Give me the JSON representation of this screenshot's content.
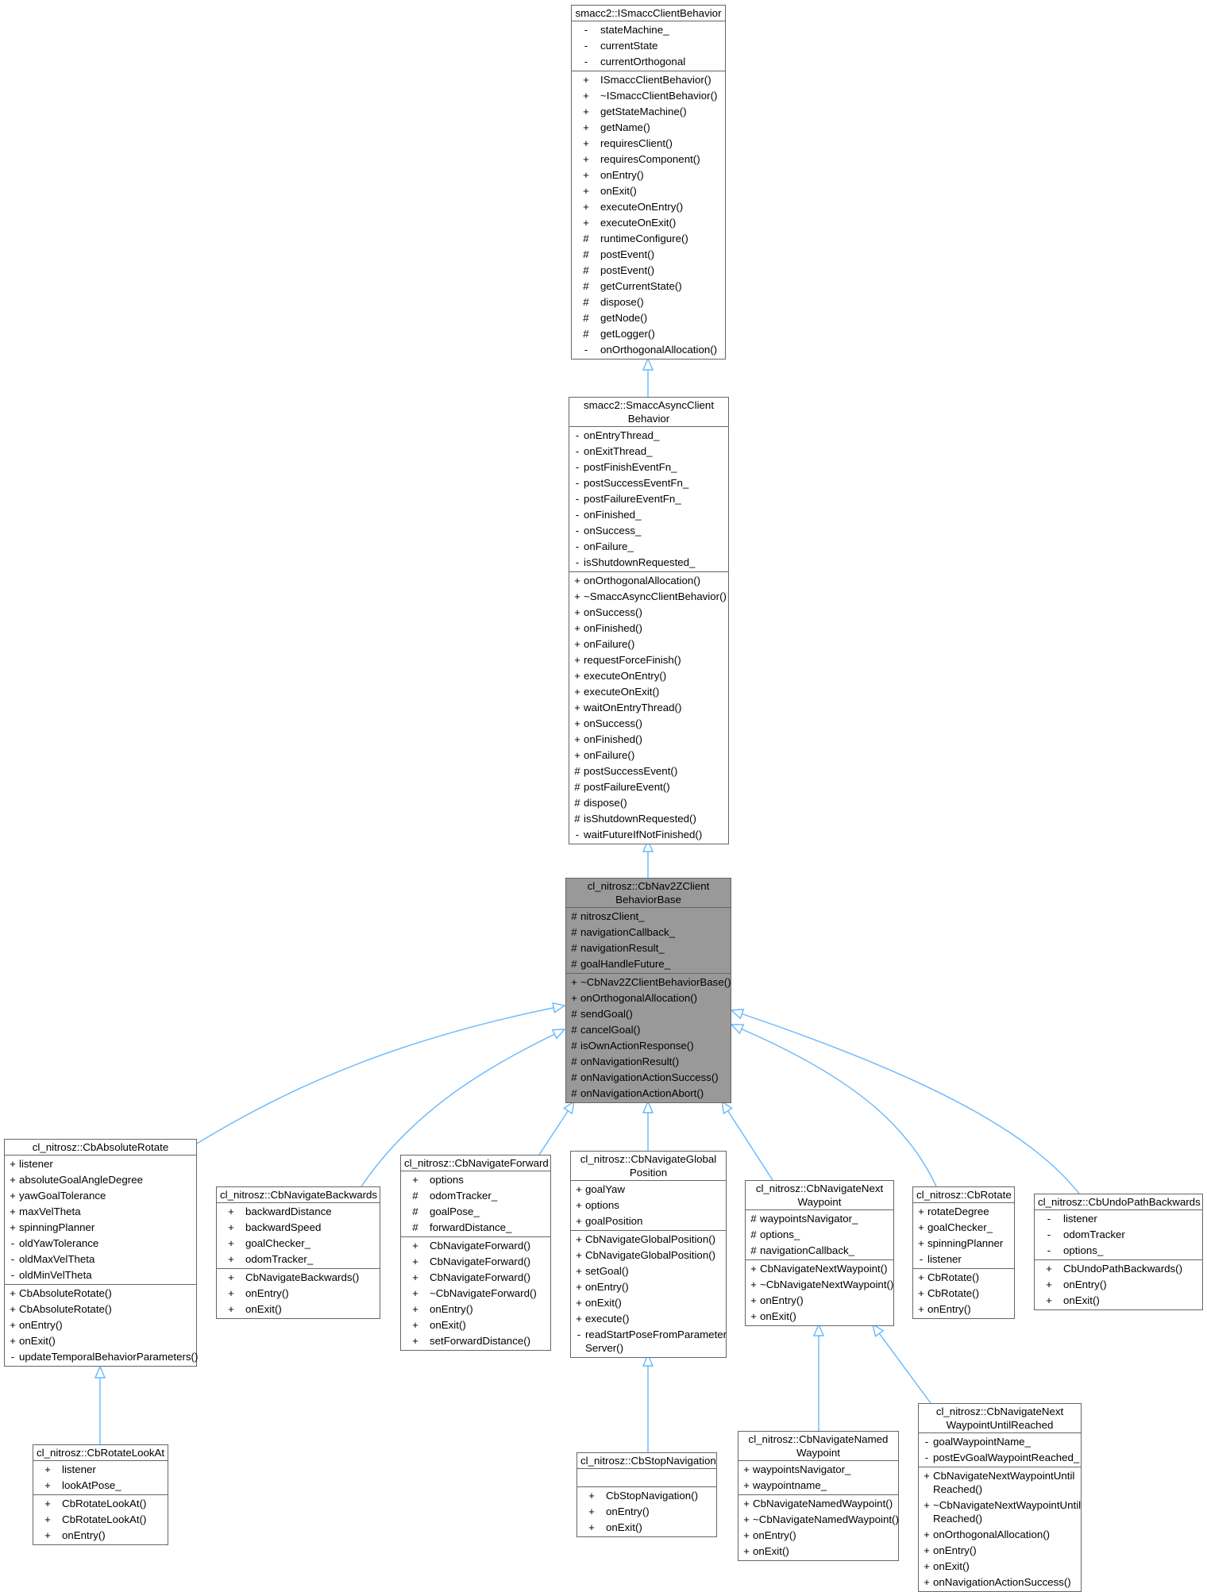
{
  "diagram": {
    "type": "class-inheritance-graph",
    "edge_color": "#63b8ff",
    "focus_fill": "#999999",
    "classes": [
      {
        "id": "ismacc",
        "name": "smacc2::ISmaccClientBehavior",
        "attributes": [
          {
            "vis": "-",
            "name": "stateMachine_"
          },
          {
            "vis": "-",
            "name": "currentState"
          },
          {
            "vis": "-",
            "name": "currentOrthogonal"
          }
        ],
        "methods": [
          {
            "vis": "+",
            "name": "ISmaccClientBehavior()"
          },
          {
            "vis": "+",
            "name": "~ISmaccClientBehavior()"
          },
          {
            "vis": "+",
            "name": "getStateMachine()"
          },
          {
            "vis": "+",
            "name": "getName()"
          },
          {
            "vis": "+",
            "name": "requiresClient()"
          },
          {
            "vis": "+",
            "name": "requiresComponent()"
          },
          {
            "vis": "+",
            "name": "onEntry()"
          },
          {
            "vis": "+",
            "name": "onExit()"
          },
          {
            "vis": "+",
            "name": "executeOnEntry()"
          },
          {
            "vis": "+",
            "name": "executeOnExit()"
          },
          {
            "vis": "#",
            "name": "runtimeConfigure()"
          },
          {
            "vis": "#",
            "name": "postEvent()"
          },
          {
            "vis": "#",
            "name": "postEvent()"
          },
          {
            "vis": "#",
            "name": "getCurrentState()"
          },
          {
            "vis": "#",
            "name": "dispose()"
          },
          {
            "vis": "#",
            "name": "getNode()"
          },
          {
            "vis": "#",
            "name": "getLogger()"
          },
          {
            "vis": "-",
            "name": "onOrthogonalAllocation()"
          }
        ]
      },
      {
        "id": "async",
        "name": "smacc2::SmaccAsyncClient\nBehavior",
        "attributes": [
          {
            "vis": "-",
            "name": "onEntryThread_"
          },
          {
            "vis": "-",
            "name": "onExitThread_"
          },
          {
            "vis": "-",
            "name": "postFinishEventFn_"
          },
          {
            "vis": "-",
            "name": "postSuccessEventFn_"
          },
          {
            "vis": "-",
            "name": "postFailureEventFn_"
          },
          {
            "vis": "-",
            "name": "onFinished_"
          },
          {
            "vis": "-",
            "name": "onSuccess_"
          },
          {
            "vis": "-",
            "name": "onFailure_"
          },
          {
            "vis": "-",
            "name": "isShutdownRequested_"
          }
        ],
        "methods": [
          {
            "vis": "+",
            "name": "onOrthogonalAllocation()"
          },
          {
            "vis": "+",
            "name": "~SmaccAsyncClientBehavior()"
          },
          {
            "vis": "+",
            "name": "onSuccess()"
          },
          {
            "vis": "+",
            "name": "onFinished()"
          },
          {
            "vis": "+",
            "name": "onFailure()"
          },
          {
            "vis": "+",
            "name": "requestForceFinish()"
          },
          {
            "vis": "+",
            "name": "executeOnEntry()"
          },
          {
            "vis": "+",
            "name": "executeOnExit()"
          },
          {
            "vis": "+",
            "name": "waitOnEntryThread()"
          },
          {
            "vis": "+",
            "name": "onSuccess()"
          },
          {
            "vis": "+",
            "name": "onFinished()"
          },
          {
            "vis": "+",
            "name": "onFailure()"
          },
          {
            "vis": "#",
            "name": "postSuccessEvent()"
          },
          {
            "vis": "#",
            "name": "postFailureEvent()"
          },
          {
            "vis": "#",
            "name": "dispose()"
          },
          {
            "vis": "#",
            "name": "isShutdownRequested()"
          },
          {
            "vis": "-",
            "name": "waitFutureIfNotFinished()"
          }
        ]
      },
      {
        "id": "base",
        "name": "cl_nitrosz::CbNav2ZClient\nBehaviorBase",
        "focus": true,
        "attributes": [
          {
            "vis": "#",
            "name": "nitroszClient_"
          },
          {
            "vis": "#",
            "name": "navigationCallback_"
          },
          {
            "vis": "#",
            "name": "navigationResult_"
          },
          {
            "vis": "#",
            "name": "goalHandleFuture_"
          }
        ],
        "methods": [
          {
            "vis": "+",
            "name": "~CbNav2ZClientBehaviorBase()"
          },
          {
            "vis": "+",
            "name": "onOrthogonalAllocation()"
          },
          {
            "vis": "#",
            "name": "sendGoal()"
          },
          {
            "vis": "#",
            "name": "cancelGoal()"
          },
          {
            "vis": "#",
            "name": "isOwnActionResponse()"
          },
          {
            "vis": "#",
            "name": "onNavigationResult()"
          },
          {
            "vis": "#",
            "name": "onNavigationActionSuccess()"
          },
          {
            "vis": "#",
            "name": "onNavigationActionAbort()"
          }
        ]
      },
      {
        "id": "absrot",
        "name": "cl_nitrosz::CbAbsoluteRotate",
        "attributes": [
          {
            "vis": "+",
            "name": "listener"
          },
          {
            "vis": "+",
            "name": "absoluteGoalAngleDegree"
          },
          {
            "vis": "+",
            "name": "yawGoalTolerance"
          },
          {
            "vis": "+",
            "name": "maxVelTheta"
          },
          {
            "vis": "+",
            "name": "spinningPlanner"
          },
          {
            "vis": "-",
            "name": "oldYawTolerance"
          },
          {
            "vis": "-",
            "name": "oldMaxVelTheta"
          },
          {
            "vis": "-",
            "name": "oldMinVelTheta"
          }
        ],
        "methods": [
          {
            "vis": "+",
            "name": "CbAbsoluteRotate()"
          },
          {
            "vis": "+",
            "name": "CbAbsoluteRotate()"
          },
          {
            "vis": "+",
            "name": "onEntry()"
          },
          {
            "vis": "+",
            "name": "onExit()"
          },
          {
            "vis": "-",
            "name": "updateTemporalBehaviorParameters()"
          }
        ]
      },
      {
        "id": "navback",
        "name": "cl_nitrosz::CbNavigateBackwards",
        "attributes": [
          {
            "vis": "+",
            "name": "backwardDistance"
          },
          {
            "vis": "+",
            "name": "backwardSpeed"
          },
          {
            "vis": "+",
            "name": "goalChecker_"
          },
          {
            "vis": "+",
            "name": "odomTracker_"
          }
        ],
        "methods": [
          {
            "vis": "+",
            "name": "CbNavigateBackwards()"
          },
          {
            "vis": "+",
            "name": "onEntry()"
          },
          {
            "vis": "+",
            "name": "onExit()"
          }
        ]
      },
      {
        "id": "navfwd",
        "name": "cl_nitrosz::CbNavigateForward",
        "attributes": [
          {
            "vis": "+",
            "name": "options"
          },
          {
            "vis": "#",
            "name": "odomTracker_"
          },
          {
            "vis": "#",
            "name": "goalPose_"
          },
          {
            "vis": "#",
            "name": "forwardDistance_"
          }
        ],
        "methods": [
          {
            "vis": "+",
            "name": "CbNavigateForward()"
          },
          {
            "vis": "+",
            "name": "CbNavigateForward()"
          },
          {
            "vis": "+",
            "name": "CbNavigateForward()"
          },
          {
            "vis": "+",
            "name": "~CbNavigateForward()"
          },
          {
            "vis": "+",
            "name": "onEntry()"
          },
          {
            "vis": "+",
            "name": "onExit()"
          },
          {
            "vis": "+",
            "name": "setForwardDistance()"
          }
        ]
      },
      {
        "id": "navglob",
        "name": "cl_nitrosz::CbNavigateGlobal\nPosition",
        "attributes": [
          {
            "vis": "+",
            "name": "goalYaw"
          },
          {
            "vis": "+",
            "name": "options"
          },
          {
            "vis": "+",
            "name": "goalPosition"
          }
        ],
        "methods": [
          {
            "vis": "+",
            "name": "CbNavigateGlobalPosition()"
          },
          {
            "vis": "+",
            "name": "CbNavigateGlobalPosition()"
          },
          {
            "vis": "+",
            "name": "setGoal()"
          },
          {
            "vis": "+",
            "name": "onEntry()"
          },
          {
            "vis": "+",
            "name": "onExit()"
          },
          {
            "vis": "+",
            "name": "execute()"
          },
          {
            "vis": "-",
            "name": "readStartPoseFromParameter\nServer()"
          }
        ]
      },
      {
        "id": "navnext",
        "name": "cl_nitrosz::CbNavigateNext\nWaypoint",
        "attributes": [
          {
            "vis": "#",
            "name": "waypointsNavigator_"
          },
          {
            "vis": "#",
            "name": "options_"
          },
          {
            "vis": "#",
            "name": "navigationCallback_"
          }
        ],
        "methods": [
          {
            "vis": "+",
            "name": "CbNavigateNextWaypoint()"
          },
          {
            "vis": "+",
            "name": "~CbNavigateNextWaypoint()"
          },
          {
            "vis": "+",
            "name": "onEntry()"
          },
          {
            "vis": "+",
            "name": "onExit()"
          }
        ]
      },
      {
        "id": "rotate",
        "name": "cl_nitrosz::CbRotate",
        "attributes": [
          {
            "vis": "+",
            "name": "rotateDegree"
          },
          {
            "vis": "+",
            "name": "goalChecker_"
          },
          {
            "vis": "+",
            "name": "spinningPlanner"
          },
          {
            "vis": "-",
            "name": "listener"
          }
        ],
        "methods": [
          {
            "vis": "+",
            "name": "CbRotate()"
          },
          {
            "vis": "+",
            "name": "CbRotate()"
          },
          {
            "vis": "+",
            "name": "onEntry()"
          }
        ]
      },
      {
        "id": "undo",
        "name": "cl_nitrosz::CbUndoPathBackwards",
        "attributes": [
          {
            "vis": "-",
            "name": "listener"
          },
          {
            "vis": "-",
            "name": "odomTracker"
          },
          {
            "vis": "-",
            "name": "options_"
          }
        ],
        "methods": [
          {
            "vis": "+",
            "name": "CbUndoPathBackwards()"
          },
          {
            "vis": "+",
            "name": "onEntry()"
          },
          {
            "vis": "+",
            "name": "onExit()"
          }
        ]
      },
      {
        "id": "lookat",
        "name": "cl_nitrosz::CbRotateLookAt",
        "attributes": [
          {
            "vis": "+",
            "name": "listener"
          },
          {
            "vis": "+",
            "name": "lookAtPose_"
          }
        ],
        "methods": [
          {
            "vis": "+",
            "name": "CbRotateLookAt()"
          },
          {
            "vis": "+",
            "name": "CbRotateLookAt()"
          },
          {
            "vis": "+",
            "name": "onEntry()"
          }
        ]
      },
      {
        "id": "stop",
        "name": "cl_nitrosz::CbStopNavigation",
        "attributes": [],
        "methods": [
          {
            "vis": "+",
            "name": "CbStopNavigation()"
          },
          {
            "vis": "+",
            "name": "onEntry()"
          },
          {
            "vis": "+",
            "name": "onExit()"
          }
        ]
      },
      {
        "id": "named",
        "name": "cl_nitrosz::CbNavigateNamed\nWaypoint",
        "attributes": [
          {
            "vis": "+",
            "name": "waypointsNavigator_"
          },
          {
            "vis": "+",
            "name": "waypointname_"
          }
        ],
        "methods": [
          {
            "vis": "+",
            "name": "CbNavigateNamedWaypoint()"
          },
          {
            "vis": "+",
            "name": "~CbNavigateNamedWaypoint()"
          },
          {
            "vis": "+",
            "name": "onEntry()"
          },
          {
            "vis": "+",
            "name": "onExit()"
          }
        ]
      },
      {
        "id": "until",
        "name": "cl_nitrosz::CbNavigateNext\nWaypointUntilReached",
        "attributes": [
          {
            "vis": "-",
            "name": "goalWaypointName_"
          },
          {
            "vis": "-",
            "name": "postEvGoalWaypointReached_"
          }
        ],
        "methods": [
          {
            "vis": "+",
            "name": "CbNavigateNextWaypointUntil\nReached()"
          },
          {
            "vis": "+",
            "name": "~CbNavigateNextWaypointUntil\nReached()"
          },
          {
            "vis": "+",
            "name": "onOrthogonalAllocation()"
          },
          {
            "vis": "+",
            "name": "onEntry()"
          },
          {
            "vis": "+",
            "name": "onExit()"
          },
          {
            "vis": "+",
            "name": "onNavigationActionSuccess()"
          }
        ]
      }
    ],
    "inheritance": [
      {
        "child": "async",
        "parent": "ismacc"
      },
      {
        "child": "base",
        "parent": "async"
      },
      {
        "child": "absrot",
        "parent": "base"
      },
      {
        "child": "navback",
        "parent": "base"
      },
      {
        "child": "navfwd",
        "parent": "base"
      },
      {
        "child": "navglob",
        "parent": "base"
      },
      {
        "child": "navnext",
        "parent": "base"
      },
      {
        "child": "rotate",
        "parent": "base"
      },
      {
        "child": "undo",
        "parent": "base"
      },
      {
        "child": "lookat",
        "parent": "absrot"
      },
      {
        "child": "stop",
        "parent": "navglob"
      },
      {
        "child": "named",
        "parent": "navnext"
      },
      {
        "child": "until",
        "parent": "navnext"
      }
    ]
  }
}
